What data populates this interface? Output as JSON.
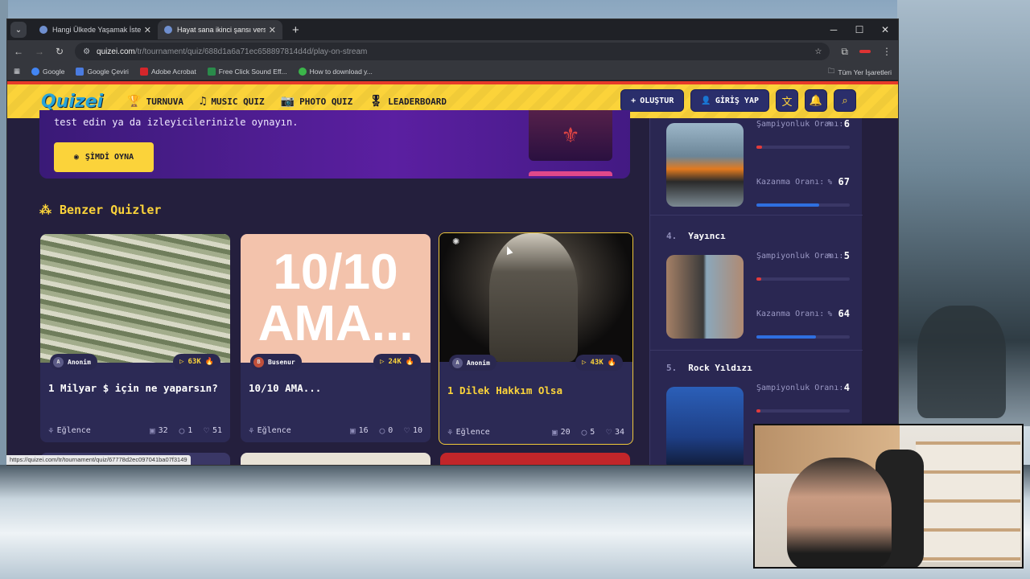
{
  "browser": {
    "tabs": [
      {
        "title": "Hangi Ülkede Yaşamak İsterdin",
        "active": false
      },
      {
        "title": "Hayat sana ikinci şansı verseydi",
        "active": true
      }
    ],
    "new_tab": "+",
    "controls": {
      "minimize": "─",
      "maximize": "☐",
      "close": "✕"
    },
    "url_host": "quizei.com",
    "url_path": "/tr/tournament/quiz/688d1a6a71ec658897814d4d/play-on-stream",
    "bookmarks": [
      {
        "label": "Google",
        "color": "#4285f4"
      },
      {
        "label": "Google Çeviri",
        "color": "#4a7be0"
      },
      {
        "label": "Adobe Acrobat",
        "color": "#d4262b"
      },
      {
        "label": "Free Click Sound Eff...",
        "color": "#2a8a4a"
      },
      {
        "label": "How to download y...",
        "color": "#3bb54a"
      }
    ],
    "all_bookmarks": "Tüm Yer İşaretleri",
    "status_url": "https://quizei.com/tr/tournament/quiz/67778d2ec097041ba07f3149"
  },
  "nav": {
    "logo": "Quizei",
    "items": [
      {
        "icon": "trophy-icon",
        "glyph": "🏆",
        "label": "TURNUVA",
        "active": true
      },
      {
        "icon": "music-icon",
        "glyph": "♫",
        "label": "MUSIC QUIZ",
        "active": false
      },
      {
        "icon": "camera-icon",
        "glyph": "📷",
        "label": "PHOTO QUIZ",
        "active": false
      },
      {
        "icon": "medal-icon",
        "glyph": "🎖",
        "label": "LEADERBOARD",
        "active": false
      }
    ],
    "create_label": "OLUŞTUR",
    "login_label": "GİRİŞ YAP"
  },
  "hero": {
    "text": "test edin ya da izleyicilerinizle oynayın.",
    "button_label": "ŞİMDİ OYNA"
  },
  "similar": {
    "title": "Benzer Quizler",
    "cards": [
      {
        "author": "Anonim",
        "author_initial": "A",
        "views": "63K",
        "title": "1 Milyar $ için ne yaparsın?",
        "category": "Eğlence",
        "questions": "32",
        "comments": "1",
        "likes": "51",
        "selected": false
      },
      {
        "author": "Busenur",
        "author_initial": "B",
        "views": "24K",
        "title": "10/10 AMA...",
        "image_text": "10/10 AMA...",
        "category": "Eğlence",
        "questions": "16",
        "comments": "0",
        "likes": "10",
        "selected": false
      },
      {
        "author": "Anonim",
        "author_initial": "A",
        "views": "43K",
        "title": "1 Dilek Hakkım Olsa",
        "category": "Eğlence",
        "questions": "20",
        "comments": "5",
        "likes": "34",
        "selected": true
      }
    ]
  },
  "leaderboard": {
    "entries": [
      {
        "rank": "",
        "name": "",
        "champ_label": "Şampiyonluk Oranı:",
        "champ_pct": "%",
        "champ_value": "6",
        "champ_fill": 0.06,
        "win_label": "Kazanma Oranı:",
        "win_pct": "%",
        "win_value": "67",
        "win_fill": 0.67
      },
      {
        "rank": "4.",
        "name": "Yayıncı",
        "champ_label": "Şampiyonluk Oranı:",
        "champ_pct": "%",
        "champ_value": "5",
        "champ_fill": 0.05,
        "win_label": "Kazanma Oranı:",
        "win_pct": "%",
        "win_value": "64",
        "win_fill": 0.64
      },
      {
        "rank": "5.",
        "name": "Rock Yıldızı",
        "champ_label": "Şampiyonluk Oranı:",
        "champ_pct": "%",
        "champ_value": "4",
        "champ_fill": 0.04
      }
    ]
  },
  "colors": {
    "accent": "#fbd33a",
    "page_bg": "#241f3d",
    "card_bg": "#2c2a55",
    "bar_blue": "#2f6fe0",
    "bar_red": "#e23b3b"
  }
}
